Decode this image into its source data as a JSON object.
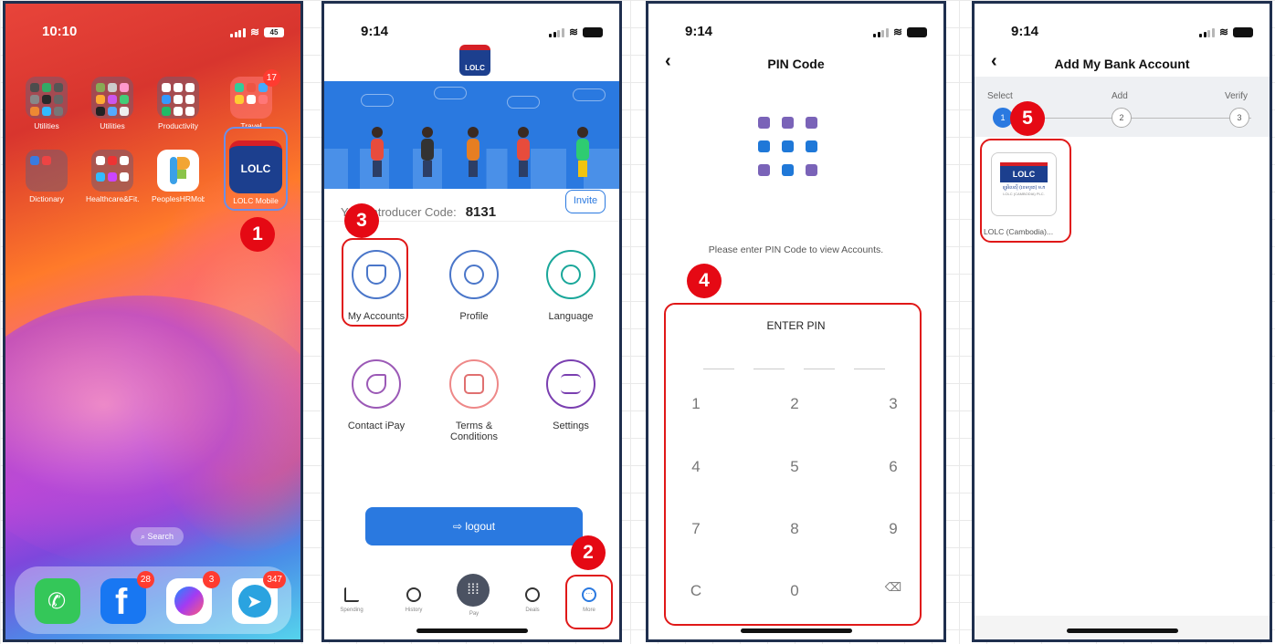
{
  "phone1": {
    "time": "10:10",
    "battery": "45",
    "apps": [
      {
        "label": "Utilities"
      },
      {
        "label": "Utilities"
      },
      {
        "label": "Productivity"
      },
      {
        "label": "Travel",
        "badge": "17"
      },
      {
        "label": "Dictionary"
      },
      {
        "label": "Healthcare&Fit..."
      },
      {
        "label": "PeoplesHRMobile"
      },
      {
        "label": "LOLC Mobile",
        "tile_text": "LOLC"
      }
    ],
    "search_label": "Search",
    "dock": [
      {
        "icon": "phone-app-icon"
      },
      {
        "icon": "facebook-app-icon",
        "badge": "28"
      },
      {
        "icon": "messenger-app-icon",
        "badge": "3"
      },
      {
        "icon": "telegram-app-icon",
        "badge": "347"
      }
    ]
  },
  "phone2": {
    "time": "9:14",
    "logo_text": "LOLC",
    "introducer_label": "Your Introducer Code:",
    "introducer_code": "8131",
    "invite_label": "Invite",
    "menu": [
      {
        "label": "My Accounts",
        "icon": "shield-icon"
      },
      {
        "label": "Profile",
        "icon": "user-icon"
      },
      {
        "label": "Language",
        "icon": "globe-chat-icon"
      },
      {
        "label": "Contact iPay",
        "icon": "phone-icon"
      },
      {
        "label": "Terms & Conditions",
        "icon": "document-icon"
      },
      {
        "label": "Settings",
        "icon": "sliders-icon"
      }
    ],
    "logout_label": "logout",
    "tabs": [
      {
        "label": "Spending"
      },
      {
        "label": "History"
      },
      {
        "label": "Pay"
      },
      {
        "label": "Deals"
      },
      {
        "label": "More"
      }
    ]
  },
  "phone3": {
    "time": "9:14",
    "title": "PIN Code",
    "hint": "Please enter PIN Code to view Accounts.",
    "enter_pin": "ENTER PIN",
    "keys": [
      "1",
      "2",
      "3",
      "4",
      "5",
      "6",
      "7",
      "8",
      "9",
      "C",
      "0"
    ]
  },
  "phone4": {
    "time": "9:14",
    "title": "Add My Bank Account",
    "steps": [
      {
        "label": "Select",
        "number": "1"
      },
      {
        "label": "Add",
        "number": "2"
      },
      {
        "label": "Verify",
        "number": "3"
      }
    ],
    "bank_logo": "LOLC",
    "bank_subtext": "ឡូអិលស៊ី (ខេមបូឌា) ម.ក",
    "bank_subtext2": "LOLC (CAMBODIA) PLC.",
    "bank_name": "LOLC (Cambodia)..."
  },
  "markers": [
    "1",
    "2",
    "3",
    "4",
    "5"
  ],
  "colors": {
    "marker_red": "#e50914",
    "brand_blue": "#2a79e0",
    "lolc_navy": "#1c3f8e",
    "lolc_red": "#d61f26",
    "frame": "#1f2f4e"
  }
}
